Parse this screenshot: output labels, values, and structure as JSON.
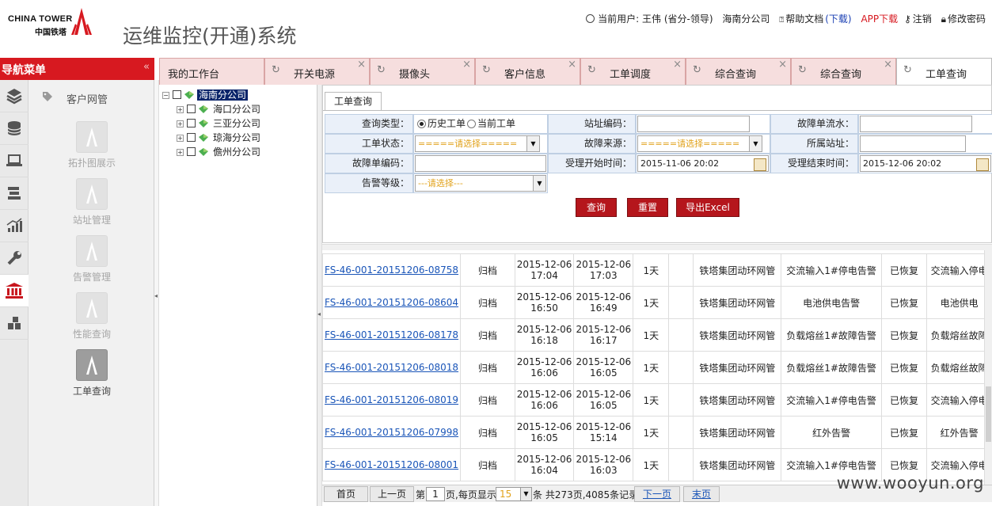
{
  "header": {
    "logo_en": "CHINA TOWER",
    "logo_cn": "中国铁塔",
    "system_title": "运维监控(开通)系统",
    "current_user": "当前用户: 王伟 (省分-领导)",
    "company": "海南分公司",
    "help_doc": "帮助文档",
    "download": "(下载)",
    "app_download": "APP下载",
    "logout": "注销",
    "change_password": "修改密码"
  },
  "nav": {
    "title": "导航菜单",
    "collapse": "«",
    "section": "客户网管",
    "modules": [
      {
        "label": "拓扑图展示",
        "active": false
      },
      {
        "label": "站址管理",
        "active": false
      },
      {
        "label": "告警管理",
        "active": false
      },
      {
        "label": "性能查询",
        "active": false
      },
      {
        "label": "工单查询",
        "active": true
      }
    ],
    "icons": [
      "layers-icon",
      "database-icon",
      "laptop-icon",
      "tools-icon",
      "chart-icon",
      "wrench-icon",
      "bank-icon",
      "blocks-icon"
    ]
  },
  "tabs": [
    {
      "label": "我的工作台"
    },
    {
      "label": "开关电源"
    },
    {
      "label": "摄像头"
    },
    {
      "label": "客户信息"
    },
    {
      "label": "工单调度"
    },
    {
      "label": "综合查询"
    },
    {
      "label": "综合查询"
    },
    {
      "label": "工单查询"
    }
  ],
  "tree": {
    "root": "海南分公司",
    "children": [
      "海口分公司",
      "三亚分公司",
      "琼海分公司",
      "儋州分公司"
    ]
  },
  "query": {
    "tab": "工单查询",
    "query_type_label": "查询类型：",
    "radio_history": "历史工单",
    "radio_current": "当前工单",
    "site_code_label": "站址编码：",
    "fault_serial_label": "故障单流水：",
    "status_label": "工单状态：",
    "status_value": "=====请选择=====",
    "source_label": "故障来源：",
    "source_value": "=====请选择=====",
    "site_label": "所属站址：",
    "fault_no_label": "故障单编码：",
    "accept_start_label": "受理开始时间：",
    "accept_start_value": "2015-11-06 20:02",
    "accept_end_label": "受理结束时间：",
    "accept_end_value": "2015-12-06 20:02",
    "alarm_level_label": "告警等级：",
    "alarm_level_value": "---请选择---",
    "btn_query": "查询",
    "btn_reset": "重置",
    "btn_export": "导出Excel"
  },
  "results": {
    "rows": [
      {
        "id": "FS-46-001-20151206-08758",
        "state": "归档",
        "t1d": "2015-12-06",
        "t1t": "17:04",
        "t2d": "2015-12-06",
        "t2t": "17:03",
        "dur": "1天",
        "blank": "",
        "org": "铁塔集团动环网管",
        "alarm": "交流输入1#停电告警",
        "rec": "已恢复",
        "alarm2": "交流输入停电"
      },
      {
        "id": "FS-46-001-20151206-08604",
        "state": "归档",
        "t1d": "2015-12-06",
        "t1t": "16:50",
        "t2d": "2015-12-06",
        "t2t": "16:49",
        "dur": "1天",
        "blank": "",
        "org": "铁塔集团动环网管",
        "alarm": "电池供电告警",
        "rec": "已恢复",
        "alarm2": "电池供电"
      },
      {
        "id": "FS-46-001-20151206-08178",
        "state": "归档",
        "t1d": "2015-12-06",
        "t1t": "16:18",
        "t2d": "2015-12-06",
        "t2t": "16:17",
        "dur": "1天",
        "blank": "",
        "org": "铁塔集团动环网管",
        "alarm": "负载熔丝1#故障告警",
        "rec": "已恢复",
        "alarm2": "负载熔丝故障"
      },
      {
        "id": "FS-46-001-20151206-08018",
        "state": "归档",
        "t1d": "2015-12-06",
        "t1t": "16:06",
        "t2d": "2015-12-06",
        "t2t": "16:05",
        "dur": "1天",
        "blank": "",
        "org": "铁塔集团动环网管",
        "alarm": "负载熔丝1#故障告警",
        "rec": "已恢复",
        "alarm2": "负载熔丝故障"
      },
      {
        "id": "FS-46-001-20151206-08019",
        "state": "归档",
        "t1d": "2015-12-06",
        "t1t": "16:06",
        "t2d": "2015-12-06",
        "t2t": "16:05",
        "dur": "1天",
        "blank": "",
        "org": "铁塔集团动环网管",
        "alarm": "交流输入1#停电告警",
        "rec": "已恢复",
        "alarm2": "交流输入停电"
      },
      {
        "id": "FS-46-001-20151206-07998",
        "state": "归档",
        "t1d": "2015-12-06",
        "t1t": "16:05",
        "t2d": "2015-12-06",
        "t2t": "15:14",
        "dur": "1天",
        "blank": "",
        "org": "铁塔集团动环网管",
        "alarm": "红外告警",
        "rec": "已恢复",
        "alarm2": "红外告警"
      },
      {
        "id": "FS-46-001-20151206-08001",
        "state": "归档",
        "t1d": "2015-12-06",
        "t1t": "16:04",
        "t2d": "2015-12-06",
        "t2t": "16:03",
        "dur": "1天",
        "blank": "",
        "org": "铁塔集团动环网管",
        "alarm": "交流输入1#停电告警",
        "rec": "已恢复",
        "alarm2": "交流输入停电"
      }
    ]
  },
  "pager": {
    "first": "首页",
    "prev": "上一页",
    "page_pre": "第",
    "page_value": "1",
    "page_mid": "页,每页显示",
    "size_value": "15",
    "summary": "条 共273页,4085条记录",
    "next": "下一页",
    "last": "末页"
  },
  "watermark": "www.wooyun.org",
  "colors": {
    "brand_red": "#d71920",
    "link_blue": "#1a55b8",
    "label_bg": "#eaf0f9"
  }
}
